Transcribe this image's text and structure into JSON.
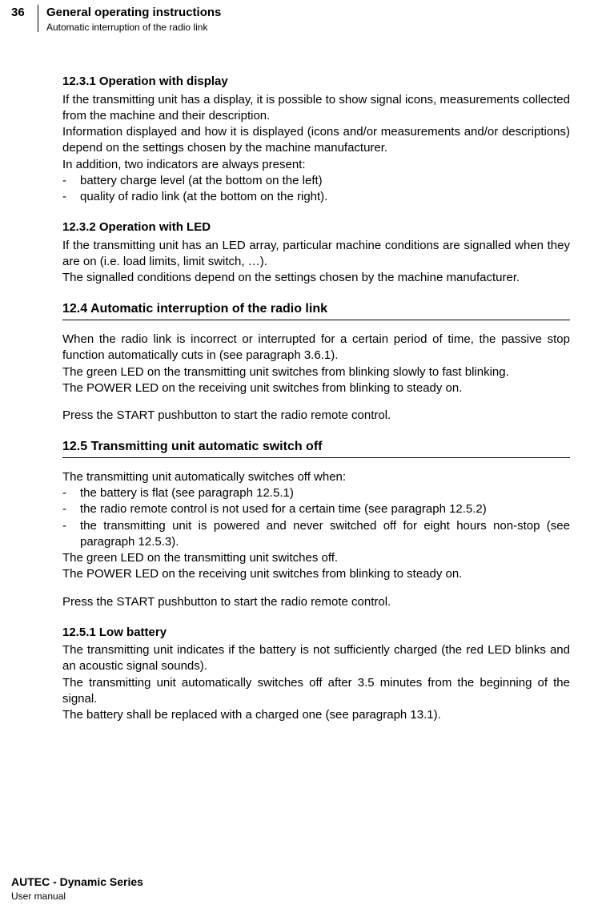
{
  "header": {
    "page_number": "36",
    "title": "General operating instructions",
    "subtitle": "Automatic interruption of the radio link"
  },
  "section_12_3_1": {
    "title": "12.3.1 Operation with display",
    "p1": "If the transmitting unit has a display, it is possible to show signal icons, measurements collected from the machine and their description.",
    "p2": "Information displayed and how it is displayed (icons and/or measurements and/or descriptions) depend on the settings chosen by the machine manufacturer.",
    "p3": "In addition, two indicators are always present:",
    "bullets": [
      "battery charge level (at the bottom on the left)",
      "quality of radio link (at the bottom on the right)."
    ]
  },
  "section_12_3_2": {
    "title": "12.3.2 Operation with LED",
    "p1": "If the transmitting unit has an LED array, particular machine conditions are signalled when they are on (i.e. load limits, limit switch, …).",
    "p2": "The signalled conditions depend on the settings chosen by the machine manufacturer."
  },
  "section_12_4": {
    "title": "12.4 Automatic interruption of the radio link",
    "p1": "When the radio link is incorrect or interrupted for a certain period of time, the passive stop function automatically cuts in (see paragraph 3.6.1).",
    "p2": "The green LED on the transmitting unit switches from blinking slowly to fast blinking.",
    "p3": "The POWER LED on the receiving unit switches from blinking to steady on.",
    "p4": "Press the START pushbutton to start the radio remote control."
  },
  "section_12_5": {
    "title": "12.5 Transmitting unit automatic switch off",
    "p1": "The transmitting unit automatically switches off when:",
    "bullets": [
      "the battery is flat (see paragraph 12.5.1)",
      "the radio remote control is not used for a certain time (see paragraph 12.5.2)",
      "the transmitting unit is powered and never switched off for eight hours non-stop (see paragraph 12.5.3)."
    ],
    "p2": "The green LED on the transmitting unit switches off.",
    "p3": "The POWER LED on the receiving unit switches from blinking to steady on.",
    "p4": "Press the START pushbutton to start the radio remote control."
  },
  "section_12_5_1": {
    "title": "12.5.1 Low battery",
    "p1": "The transmitting unit indicates if the battery is not sufficiently charged (the red LED blinks and an acoustic signal sounds).",
    "p2": "The transmitting unit automatically switches off after 3.5 minutes from the beginning of the signal.",
    "p3": "The battery shall be replaced with a charged one (see paragraph 13.1)."
  },
  "footer": {
    "title": "AUTEC - Dynamic Series",
    "subtitle": "User manual"
  }
}
